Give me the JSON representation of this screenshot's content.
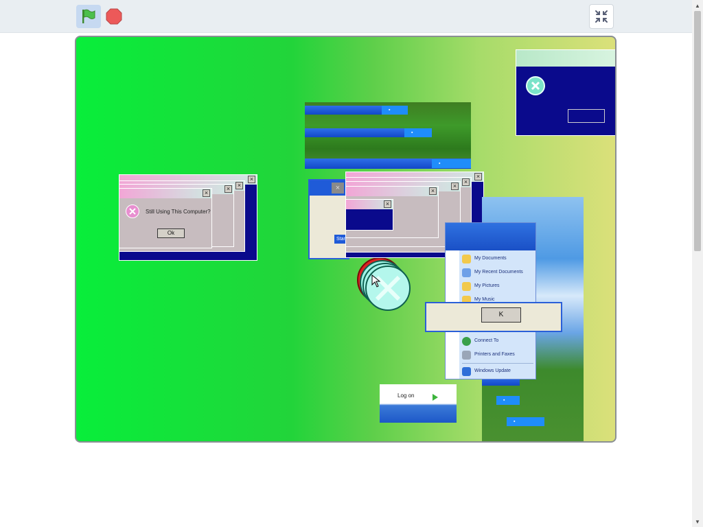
{
  "toolbar": {
    "green_flag": "green-flag-icon",
    "stop": "stop-icon",
    "fullscreen": "exit-fullscreen-icon"
  },
  "dialogs": {
    "left_message": "Still Using This Computer?",
    "left_ok": "Ok",
    "right_ok": "",
    "center_ok": "K"
  },
  "taskbars": {
    "start_label": "Start"
  },
  "start_menu": {
    "items_top": [
      "My Documents",
      "My Recent Documents",
      "My Pictures",
      "My Music"
    ],
    "items_bottom": [
      "Connect To",
      "Printers and Faxes",
      "Windows Update"
    ]
  },
  "login_button": {
    "label": "Log on"
  },
  "colors": {
    "accent_blue": "#1248c8",
    "dialog_navy": "#0a0a8c",
    "stage_green": "#08ee3a"
  }
}
